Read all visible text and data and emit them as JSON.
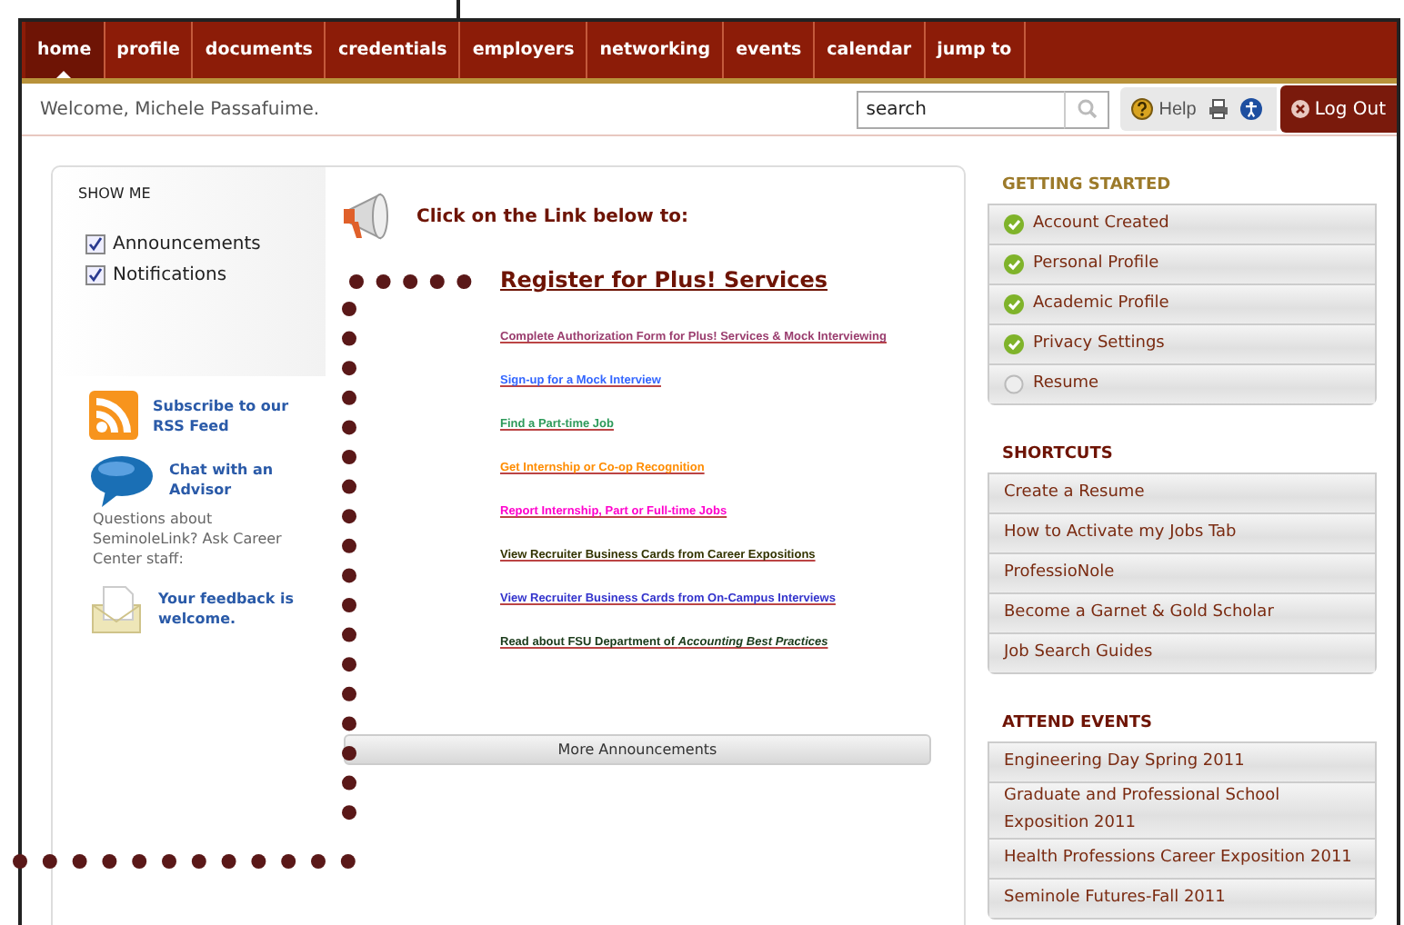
{
  "nav": {
    "tabs": [
      {
        "label": "home",
        "selected": true
      },
      {
        "label": "profile",
        "selected": false
      },
      {
        "label": "documents",
        "selected": false
      },
      {
        "label": "credentials",
        "selected": false
      },
      {
        "label": "employers",
        "selected": false
      },
      {
        "label": "networking",
        "selected": false
      },
      {
        "label": "events",
        "selected": false
      },
      {
        "label": "calendar",
        "selected": false
      },
      {
        "label": "jump to",
        "selected": false
      }
    ]
  },
  "welcome": "Welcome, Michele Passafuime.",
  "search": {
    "value": "search"
  },
  "help": "Help",
  "logout": "Log Out",
  "show_me": {
    "title": "SHOW ME",
    "options": [
      {
        "label": "Announcements",
        "checked": true
      },
      {
        "label": "Notifications",
        "checked": true
      }
    ]
  },
  "side_links": [
    {
      "kind": "rss",
      "text": "Subscribe to our RSS Feed"
    },
    {
      "kind": "chat",
      "text": "Chat with an Advisor",
      "note": "Questions about SeminoleLink? Ask Career Center staff:"
    },
    {
      "kind": "feedback",
      "text": "Your feedback is welcome."
    }
  ],
  "announcement": {
    "heading": "Click on the Link below to:",
    "main_link": "Register for Plus! Services",
    "links": [
      {
        "text": "Complete Authorization Form for Plus! Services & Mock Interviewing",
        "color": "#9a3d6e"
      },
      {
        "text": "Sign-up for a Mock Interview",
        "color": "#3366ff"
      },
      {
        "text": "Find a Part-time Job",
        "color": "#2e9a5a"
      },
      {
        "text": "Get Internship or Co-op Recognition",
        "color": "#ff8c00"
      },
      {
        "text": "Report Internship, Part or Full-time Jobs",
        "color": "#ff00cc"
      },
      {
        "text": "View Recruiter Business Cards from Career Expositions",
        "color": "#333300"
      },
      {
        "text": "View Recruiter Business Cards from On-Campus Interviews",
        "color": "#3333cc"
      },
      {
        "text": "Read about FSU Department of *Accounting Best Practices*",
        "color": "#1a3a1a"
      }
    ],
    "more": "More Announcements"
  },
  "sidebar": [
    {
      "title": "GETTING STARTED",
      "kind": "checklist",
      "items": [
        {
          "label": "Account Created",
          "checked": true
        },
        {
          "label": "Personal Profile",
          "checked": true
        },
        {
          "label": "Academic Profile",
          "checked": true
        },
        {
          "label": "Privacy Settings",
          "checked": true
        },
        {
          "label": "Resume",
          "checked": false
        }
      ]
    },
    {
      "title": "SHORTCUTS",
      "kind": "links",
      "items": [
        {
          "label": "Create a Resume"
        },
        {
          "label": "How to Activate my Jobs Tab"
        },
        {
          "label": "ProfessioNole"
        },
        {
          "label": "Become a Garnet & Gold Scholar"
        },
        {
          "label": "Job Search Guides"
        }
      ]
    },
    {
      "title": "ATTEND EVENTS",
      "kind": "links",
      "items": [
        {
          "label": "Engineering Day Spring 2011"
        },
        {
          "label": "Graduate and Professional School Exposition 2011"
        },
        {
          "label": "Health Professions Career Exposition 2011"
        },
        {
          "label": "Seminole Futures-Fall 2011"
        }
      ]
    }
  ]
}
